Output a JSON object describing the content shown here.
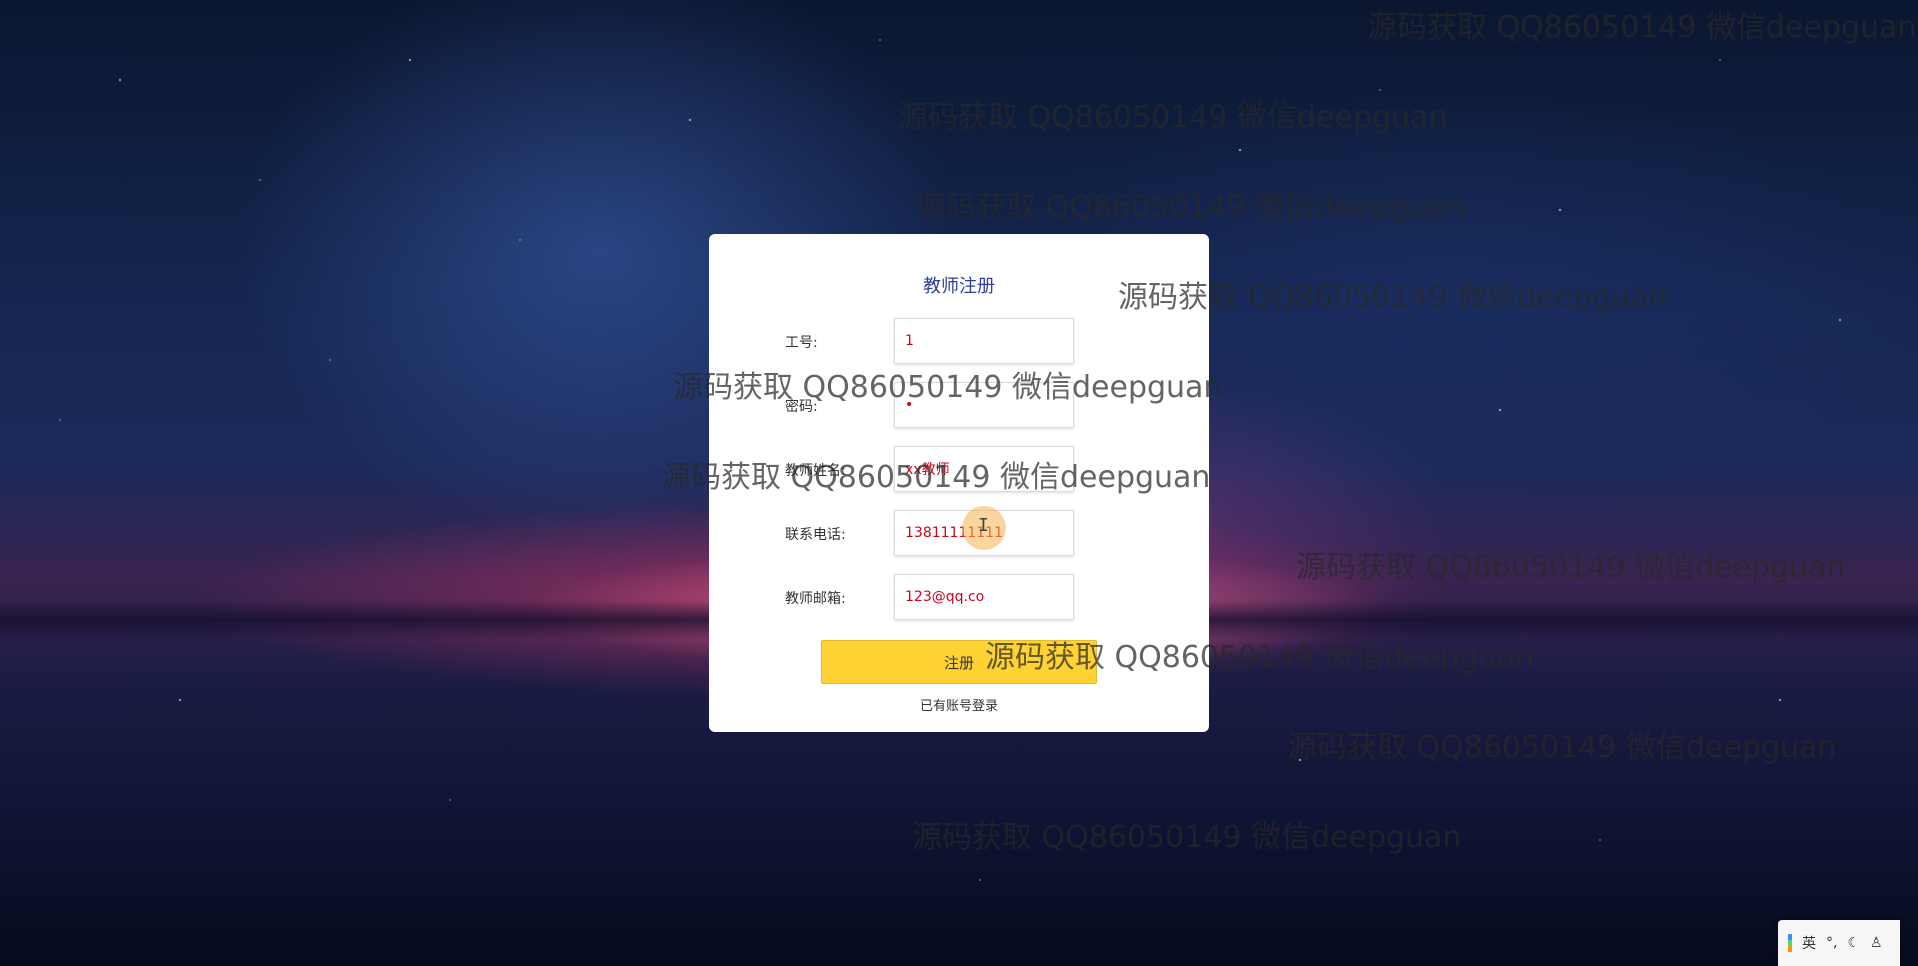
{
  "form": {
    "title": "教师注册",
    "fields": [
      {
        "label": "工号:",
        "value": "1"
      },
      {
        "label": "密码:",
        "value": "•"
      },
      {
        "label": "教师姓名:",
        "value": "xx教师"
      },
      {
        "label": "联系电话:",
        "value": "13811111111"
      },
      {
        "label": "教师邮箱:",
        "value": "123@qq.co"
      }
    ],
    "submit_label": "注册",
    "login_link": "已有账号登录"
  },
  "watermark_text": "源码获取 QQ86050149 微信deepguan",
  "ime": {
    "lang": "英",
    "icons": [
      "dot-comma-icon",
      "moon-icon",
      "shirt-icon"
    ]
  }
}
